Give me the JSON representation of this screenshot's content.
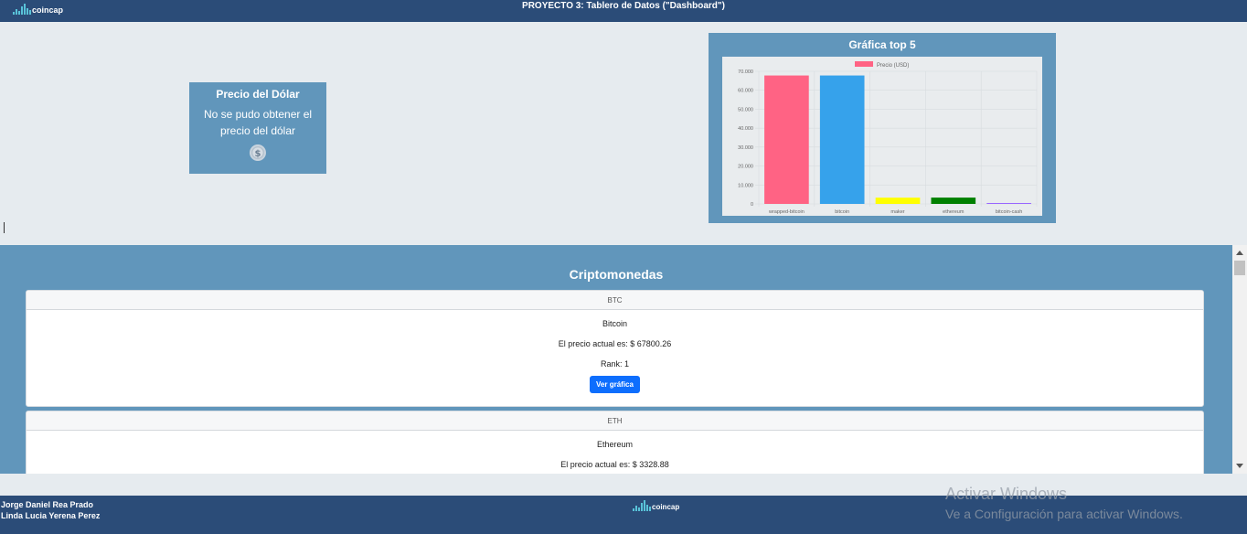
{
  "header": {
    "logo_text": "coincap",
    "title": "PROYECTO 3: Tablero de Datos (\"Dashboard\")"
  },
  "dollar": {
    "title": "Precio del Dólar",
    "message": "No se pudo obtener el precio del dólar",
    "icon": "dollar-coin-icon"
  },
  "chart_card": {
    "title": "Gráfica top 5"
  },
  "chart_data": {
    "type": "bar",
    "title": "Gráfica top 5",
    "categories": [
      "wrapped-bitcoin",
      "bitcoin",
      "maker",
      "ethereum",
      "bitcoin-cash"
    ],
    "series": [
      {
        "name": "Precio (USD)",
        "values": [
          67800,
          67800,
          3300,
          3329,
          480
        ]
      }
    ],
    "bar_colors": [
      "#ff6384",
      "#36a2eb",
      "#ffff00",
      "#008000",
      "#9966ff"
    ],
    "legend_color": "#ff6384",
    "yticks": [
      "0",
      "10.000",
      "20.000",
      "30.000",
      "40.000",
      "50.000",
      "60.000",
      "70.000"
    ],
    "ylim": [
      0,
      70000
    ],
    "grid": true,
    "legend_position": "top"
  },
  "crypto": {
    "heading": "Criptomonedas",
    "coins": [
      {
        "symbol": "BTC",
        "name": "Bitcoin",
        "price_text": "El precio actual es: $ 67800.26",
        "rank_text": "Rank: 1",
        "button": "Ver gráfica"
      },
      {
        "symbol": "ETH",
        "name": "Ethereum",
        "price_text": "El precio actual es: $ 3328.88"
      }
    ]
  },
  "footer": {
    "names": [
      "Jorge Daniel Rea Prado",
      "Linda Lucia Yerena Perez"
    ],
    "logo_text": "coincap"
  },
  "watermark": {
    "line1": "Activar Windows",
    "line2": "Ve a Configuración para activar Windows."
  },
  "colors": {
    "header_bg": "#2b4c78",
    "panel_bg": "#6196bb",
    "page_bg": "#e6ebef",
    "button": "#0d6efd"
  }
}
